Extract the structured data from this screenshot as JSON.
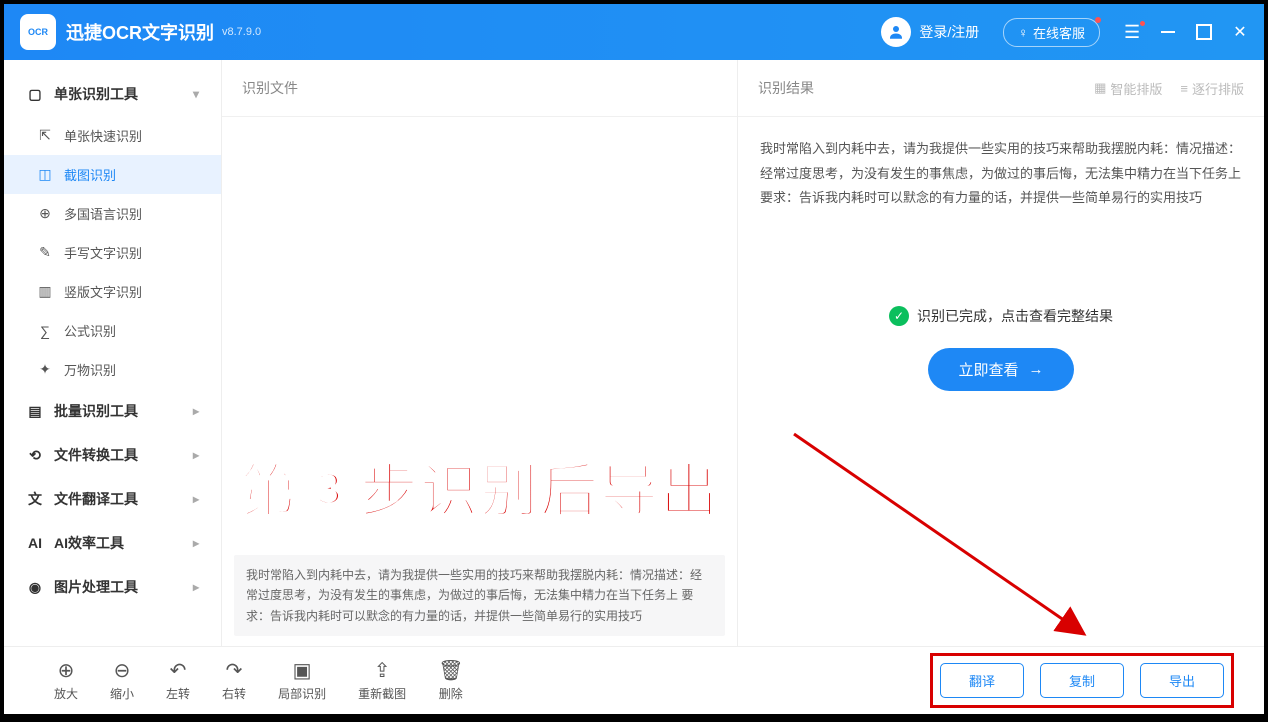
{
  "app": {
    "title": "迅捷OCR文字识别",
    "version": "v8.7.9.0",
    "loginText": "登录/注册",
    "supportBtn": "在线客服"
  },
  "sidebar": {
    "g0": {
      "label": "单张识别工具"
    },
    "items": [
      {
        "label": "单张快速识别"
      },
      {
        "label": "截图识别"
      },
      {
        "label": "多国语言识别"
      },
      {
        "label": "手写文字识别"
      },
      {
        "label": "竖版文字识别"
      },
      {
        "label": "公式识别"
      },
      {
        "label": "万物识别"
      }
    ],
    "groups": [
      {
        "label": "批量识别工具"
      },
      {
        "label": "文件转换工具"
      },
      {
        "label": "文件翻译工具"
      },
      {
        "label": "AI效率工具"
      },
      {
        "label": "图片处理工具"
      }
    ]
  },
  "left": {
    "header": "识别文件",
    "previewText": "我时常陷入到内耗中去，请为我提供一些实用的技巧来帮助我摆脱内耗：情况描述：经常过度思考，为没有发生的事焦虑，为做过的事后悔，无法集中精力在当下任务上 要求：告诉我内耗时可以默念的有力量的话，并提供一些简单易行的实用技巧"
  },
  "right": {
    "header": "识别结果",
    "layout1": "智能排版",
    "layout2": "逐行排版",
    "resultText": "我时常陷入到内耗中去，请为我提供一些实用的技巧来帮助我摆脱内耗：情况描述：经常过度思考，为没有发生的事焦虑，为做过的事后悔，无法集中精力在当下任务上要求：告诉我内耗时可以默念的有力量的话，并提供一些简单易行的实用技巧",
    "completeText": "识别已完成，点击查看完整结果",
    "viewBtn": "立即查看"
  },
  "toolbar": {
    "tools": [
      {
        "label": "放大"
      },
      {
        "label": "缩小"
      },
      {
        "label": "左转"
      },
      {
        "label": "右转"
      },
      {
        "label": "局部识别"
      },
      {
        "label": "重新截图"
      },
      {
        "label": "删除"
      }
    ],
    "actions": {
      "translate": "翻译",
      "copy": "复制",
      "export": "导出"
    }
  },
  "overlay": {
    "stepText": "第③步识别后导出"
  }
}
